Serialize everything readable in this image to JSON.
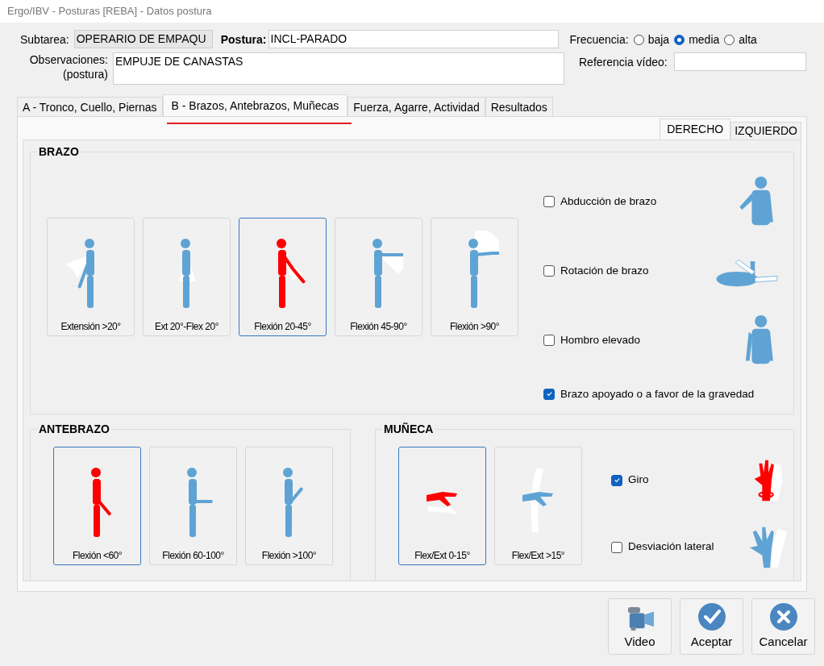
{
  "window": {
    "title": "Ergo/IBV - Posturas [REBA] - Datos postura"
  },
  "header": {
    "subtarea_label": "Subtarea:",
    "subtarea": "OPERARIO DE EMPAQU",
    "postura_label": "Postura:",
    "postura": "INCL-PARADO",
    "frecuencia_label": "Frecuencia:",
    "frecuencia": [
      {
        "label": "baja",
        "selected": false
      },
      {
        "label": "media",
        "selected": true
      },
      {
        "label": "alta",
        "selected": false
      }
    ],
    "observaciones_label": "Observaciones:",
    "observaciones_sub": "(postura)",
    "observaciones": "EMPUJE DE CANASTAS",
    "referencia_label": "Referencia vídeo:"
  },
  "tabs": [
    {
      "label": "A - Tronco, Cuello, Piernas",
      "selected": false
    },
    {
      "label": "B - Brazos, Antebrazos, Muñecas",
      "selected": true
    },
    {
      "label": "Fuerza, Agarre, Actividad",
      "selected": false
    },
    {
      "label": "Resultados",
      "selected": false
    }
  ],
  "side_tabs": [
    {
      "label": "DERECHO",
      "selected": true
    },
    {
      "label": "IZQUIERDO",
      "selected": false
    }
  ],
  "brazo": {
    "title": "BRAZO",
    "options": [
      {
        "label": "Extensión >20°",
        "selected": false
      },
      {
        "label": "Ext 20°-Flex 20°",
        "selected": false
      },
      {
        "label": "Flexión 20-45°",
        "selected": true
      },
      {
        "label": "Flexión 45-90°",
        "selected": false
      },
      {
        "label": "Flexión >90°",
        "selected": false
      }
    ],
    "checks": [
      {
        "label": "Abducción de brazo",
        "checked": false,
        "kind": "abduction"
      },
      {
        "label": "Rotación de brazo",
        "checked": false,
        "kind": "rotation"
      },
      {
        "label": "Hombro elevado",
        "checked": false,
        "kind": "shoulder"
      },
      {
        "label": "Brazo apoyado o a favor de la gravedad",
        "checked": true,
        "kind": "none"
      }
    ]
  },
  "antebrazo": {
    "title": "ANTEBRAZO",
    "options": [
      {
        "label": "Flexión <60°",
        "selected": true
      },
      {
        "label": "Flexión 60-100°",
        "selected": false
      },
      {
        "label": "Flexión >100°",
        "selected": false
      }
    ]
  },
  "muneca": {
    "title": "MUÑECA",
    "options": [
      {
        "label": "Flex/Ext 0-15°",
        "selected": true
      },
      {
        "label": "Flex/Ext >15°",
        "selected": false
      }
    ],
    "checks": [
      {
        "label": "Giro",
        "checked": true,
        "kind": "twist"
      },
      {
        "label": "Desviación lateral",
        "checked": false,
        "kind": "deviation"
      }
    ]
  },
  "buttons": [
    {
      "label": "Video",
      "kind": "video"
    },
    {
      "label": "Aceptar",
      "kind": "accept"
    },
    {
      "label": "Cancelar",
      "kind": "cancel"
    }
  ]
}
